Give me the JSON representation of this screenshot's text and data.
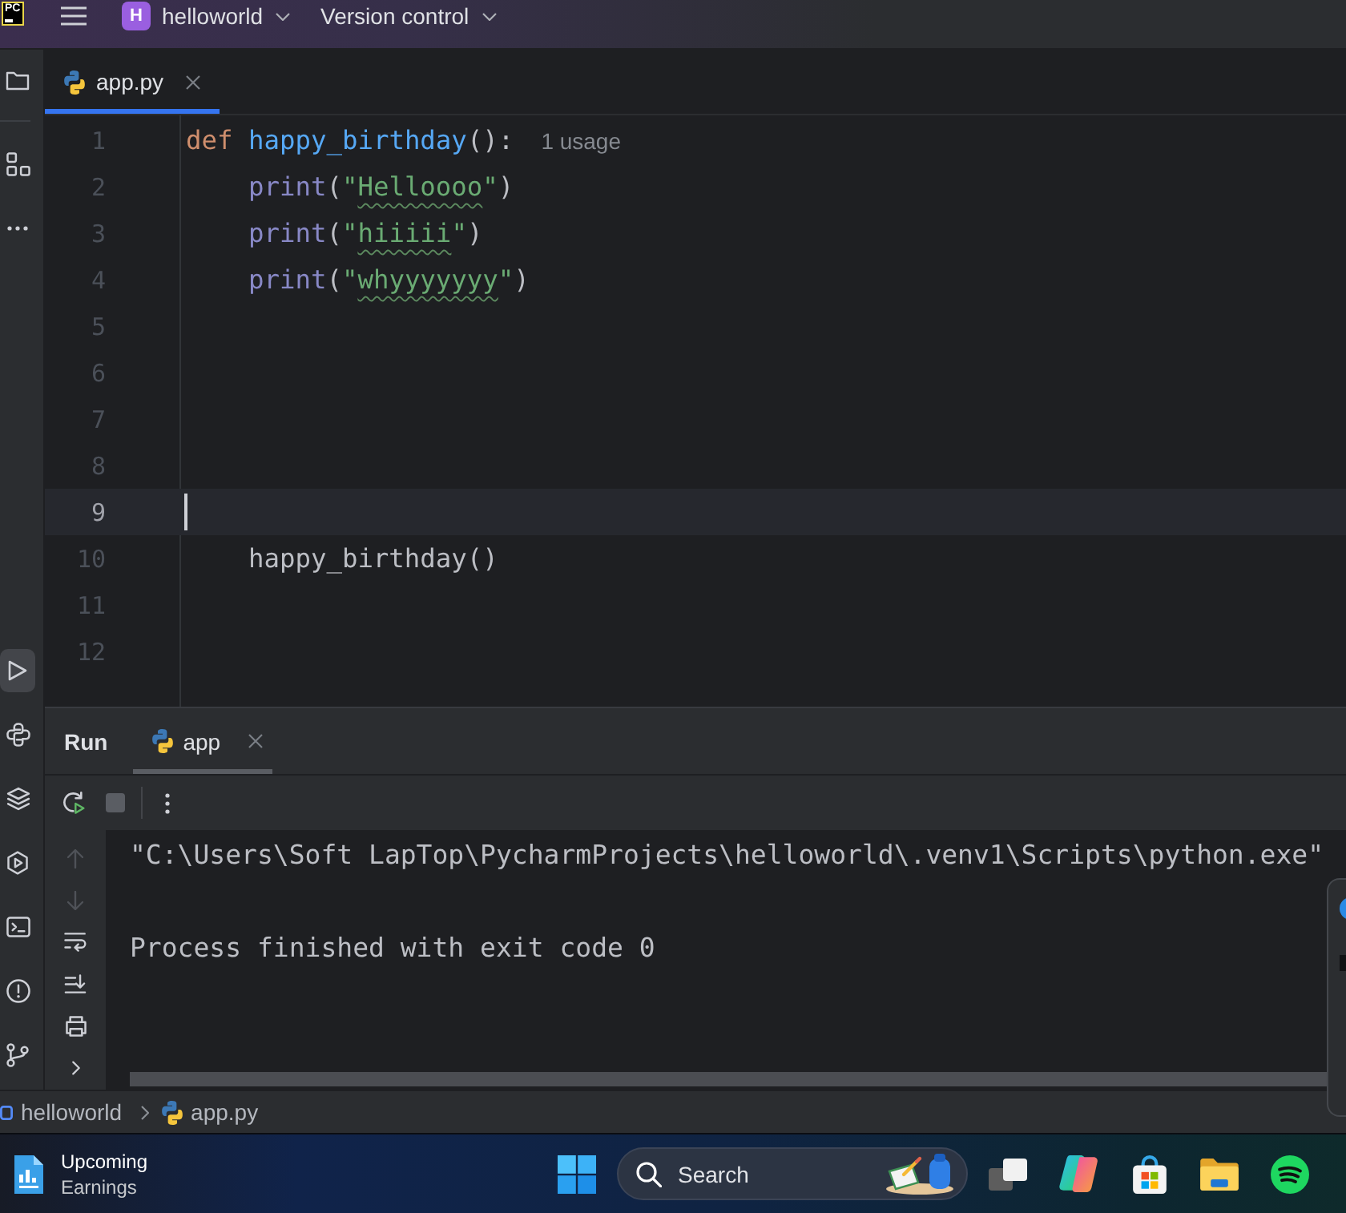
{
  "title_bar": {
    "logo": "PC",
    "project": {
      "initial": "H",
      "name": "helloworld"
    },
    "menus": [
      {
        "label": "Version control"
      }
    ]
  },
  "tool_strip": {
    "top": [
      {
        "kind": "project",
        "selected": false
      },
      {
        "kind": "structure",
        "selected": false
      },
      {
        "kind": "more",
        "selected": false
      }
    ],
    "bottom": [
      {
        "kind": "run",
        "selected": true
      },
      {
        "kind": "python_console",
        "selected": false
      },
      {
        "kind": "packages",
        "selected": false
      },
      {
        "kind": "services",
        "selected": false
      },
      {
        "kind": "terminal",
        "selected": false
      },
      {
        "kind": "problems",
        "selected": false
      },
      {
        "kind": "git",
        "selected": false
      }
    ]
  },
  "editor": {
    "tabs": [
      {
        "label": "app.py",
        "selected": true
      }
    ],
    "lines": [
      {
        "number": "1",
        "current": false,
        "tokens": [
          {
            "kind": "keyword",
            "text": "def "
          },
          {
            "kind": "function",
            "text": "happy_birthday"
          },
          {
            "kind": "plain",
            "text": "():"
          }
        ],
        "hint": "1 usage",
        "children": [
          {
            "number": "2",
            "current": false,
            "tokens": [
              {
                "kind": "builtin",
                "text": "print"
              },
              {
                "kind": "plain",
                "text": "("
              },
              {
                "kind": "string",
                "text": "\""
              },
              {
                "kind": "misspelled",
                "text": "Helloooo"
              },
              {
                "kind": "string",
                "text": "\""
              },
              {
                "kind": "plain",
                "text": ")"
              }
            ]
          },
          {
            "number": "3",
            "current": false,
            "tokens": [
              {
                "kind": "builtin",
                "text": "print"
              },
              {
                "kind": "plain",
                "text": "("
              },
              {
                "kind": "string",
                "text": "\""
              },
              {
                "kind": "misspelled",
                "text": "hiiiii"
              },
              {
                "kind": "string",
                "text": "\""
              },
              {
                "kind": "plain",
                "text": ")"
              }
            ]
          },
          {
            "number": "4",
            "current": false,
            "tokens": [
              {
                "kind": "builtin",
                "text": "print"
              },
              {
                "kind": "plain",
                "text": "("
              },
              {
                "kind": "string",
                "text": "\""
              },
              {
                "kind": "misspelled",
                "text": "whyyyyyyy"
              },
              {
                "kind": "string",
                "text": "\""
              },
              {
                "kind": "plain",
                "text": ")"
              }
            ]
          },
          {
            "number": "5",
            "current": false
          },
          {
            "number": "6",
            "current": false
          },
          {
            "number": "7",
            "current": false
          },
          {
            "number": "8",
            "current": false
          },
          {
            "number": "9",
            "current": true
          },
          {
            "number": "10",
            "current": false,
            "tokens": [
              {
                "kind": "plain",
                "text": "happy_birthday()"
              }
            ]
          }
        ]
      },
      {
        "number": "11",
        "current": false
      },
      {
        "number": "12",
        "current": false
      }
    ]
  },
  "run_panel": {
    "title": "Run",
    "tabs": [
      {
        "label": "app",
        "selected": true
      }
    ],
    "toolbar_groups": [
      {
        "items": [
          {
            "kind": "rerun",
            "disabled": false
          },
          {
            "kind": "stop",
            "disabled": true
          }
        ]
      },
      {
        "items": [
          {
            "kind": "more",
            "disabled": false
          }
        ]
      }
    ],
    "side_tools": [
      {
        "kind": "up",
        "disabled": true
      },
      {
        "kind": "down",
        "disabled": true
      },
      {
        "kind": "soft_wrap",
        "disabled": false
      },
      {
        "kind": "scroll_end",
        "disabled": false
      },
      {
        "kind": "print",
        "disabled": false
      },
      {
        "kind": "expand",
        "disabled": false
      }
    ],
    "output": [
      {
        "kind": "command",
        "text": "\"C:\\Users\\Soft LapTop\\PycharmProjects\\helloworld\\.venv1\\Scripts\\python.exe\""
      },
      {
        "kind": "status",
        "text": "Process finished with exit code 0"
      }
    ]
  },
  "breadcrumbs": [
    {
      "kind": "module",
      "label": "helloworld"
    },
    {
      "kind": "python_file",
      "label": "app.py"
    }
  ],
  "taskbar": {
    "widget": {
      "title": "Upcoming",
      "subtitle": "Earnings"
    },
    "search": {
      "placeholder": "Search"
    },
    "apps": [
      {
        "kind": "task_view"
      },
      {
        "kind": "copilot"
      },
      {
        "kind": "store"
      },
      {
        "kind": "file_explorer"
      },
      {
        "kind": "spotify"
      }
    ]
  }
}
